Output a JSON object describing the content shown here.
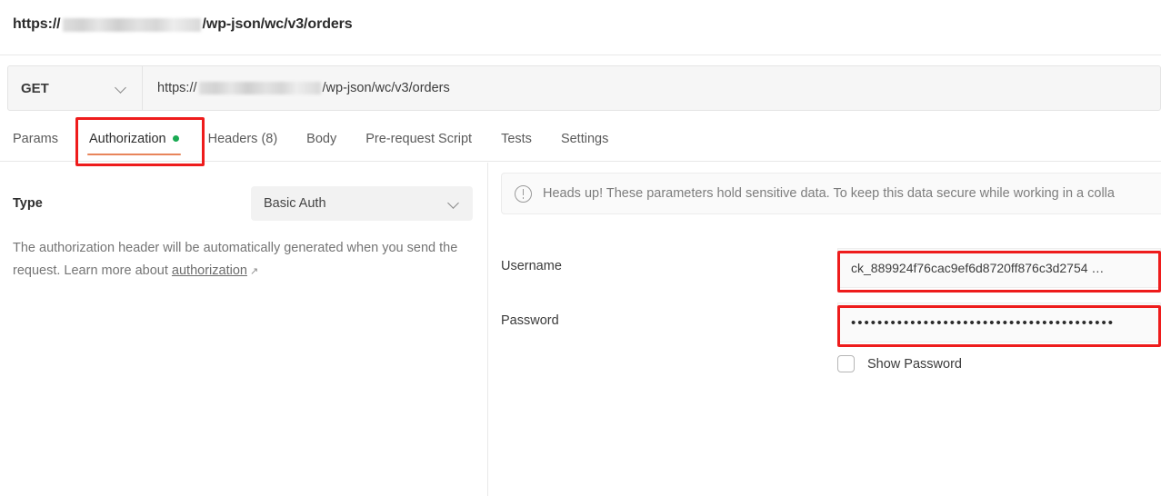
{
  "request": {
    "title_prefix": "https://",
    "title_suffix": "/wp-json/wc/v3/orders",
    "method": "GET",
    "url_prefix": "https://",
    "url_suffix": "/wp-json/wc/v3/orders"
  },
  "tabs": [
    {
      "label": "Params",
      "active": false,
      "dot": false
    },
    {
      "label": "Authorization",
      "active": true,
      "dot": true
    },
    {
      "label": "Headers (8)",
      "active": false,
      "dot": false
    },
    {
      "label": "Body",
      "active": false,
      "dot": false
    },
    {
      "label": "Pre-request Script",
      "active": false,
      "dot": false
    },
    {
      "label": "Tests",
      "active": false,
      "dot": false
    },
    {
      "label": "Settings",
      "active": false,
      "dot": false
    }
  ],
  "auth": {
    "type_label": "Type",
    "type_value": "Basic Auth",
    "help_line1": "The authorization header will be automatically generated when you",
    "help_line2": "send the request. Learn more about ",
    "help_link": "authorization",
    "help_link_arrow": "↗"
  },
  "notice": {
    "text": "Heads up! These parameters hold sensitive data. To keep this data secure while working in a colla"
  },
  "fields": {
    "username_label": "Username",
    "username_value": "ck_889924f76cac9ef6d8720ff876c3d2754 …",
    "password_label": "Password",
    "password_value": "••••••••••••••••••••••••••••••••••••••••",
    "show_password_label": "Show Password"
  },
  "colors": {
    "highlight": "#ee1c1c",
    "active_tab_underline": "#e8855b",
    "status_dot": "#1aaa53"
  }
}
